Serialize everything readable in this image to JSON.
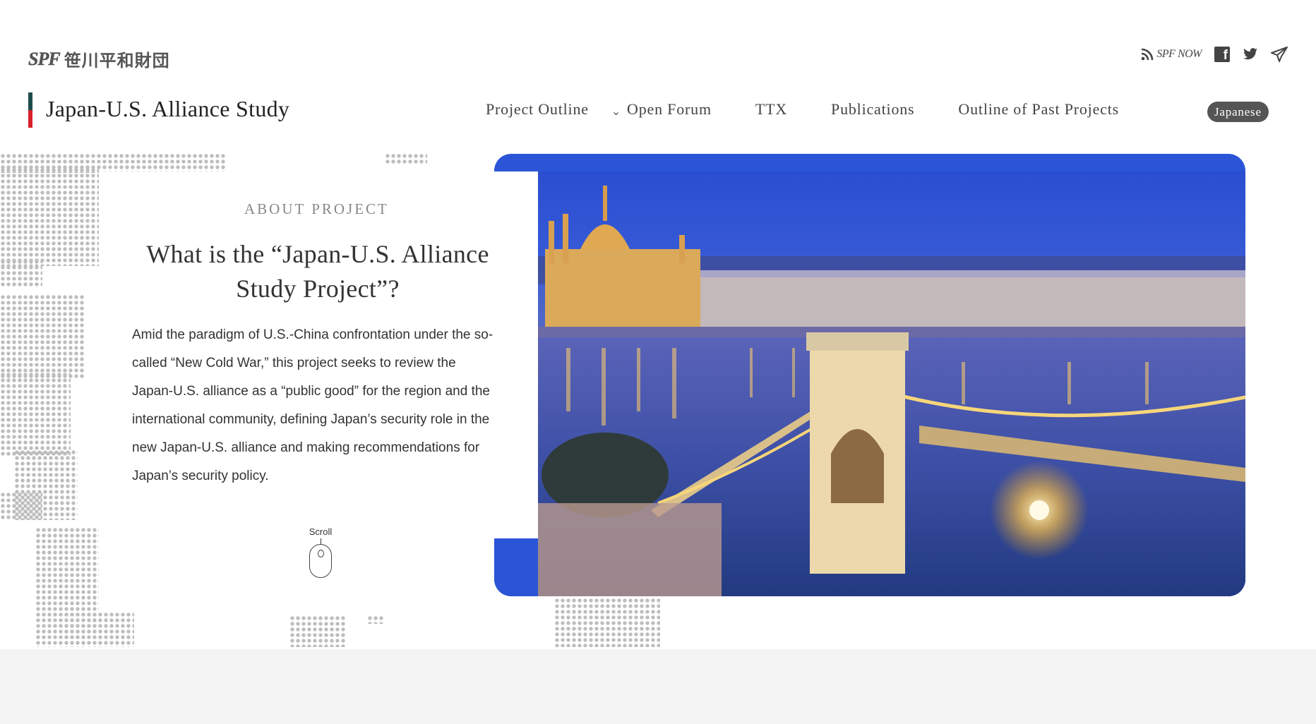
{
  "brand": {
    "logo_mark": "SPF",
    "logo_text": "笹川平和財団"
  },
  "social": {
    "spf_now_label": "SPF NOW",
    "facebook_glyph": "f"
  },
  "header": {
    "site_title": "Japan-U.S. Alliance Study",
    "title_bar_colors": [
      "#1f4d4d",
      "#d8202a"
    ],
    "nav": [
      {
        "label": "Project Outline"
      },
      {
        "label": "Open Forum",
        "has_dropdown": true
      },
      {
        "label": "TTX"
      },
      {
        "label": "Publications"
      },
      {
        "label": "Outline of Past Projects"
      }
    ],
    "language_button": "Japanese"
  },
  "hero": {
    "about_label": "ABOUT PROJECT",
    "title": "What is the “Japan-U.S. Alliance Study Project”?",
    "body": "Amid the paradigm of U.S.-China confrontation under the so-called “New Cold War,” this project seeks to review the Japan-U.S. alliance as a “public good” for the region and the international community, defining Japan’s security role in the new Japan-U.S. alliance and making recommendations for Japan’s security policy.",
    "scroll_label": "Scroll",
    "accent_color": "#2a55d6"
  }
}
